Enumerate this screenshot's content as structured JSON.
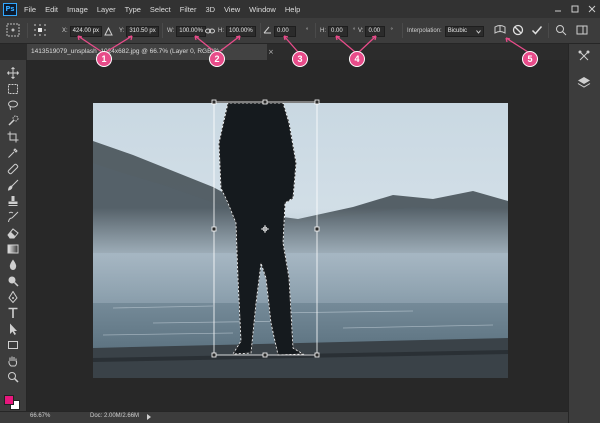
{
  "app": {
    "logo": "Ps"
  },
  "menu": [
    "File",
    "Edit",
    "Image",
    "Layer",
    "Type",
    "Select",
    "Filter",
    "3D",
    "View",
    "Window",
    "Help"
  ],
  "window_controls": [
    "minimize-icon",
    "maximize-icon",
    "close-icon"
  ],
  "options": {
    "x_label": "X:",
    "x_value": "424.00 px",
    "y_label": "Y:",
    "y_value": "310.50 px",
    "w_label": "W:",
    "w_value": "100.00%",
    "h_label": "H:",
    "h_value": "100.00%",
    "angle_value": "0.00",
    "angle_unit": "°",
    "hskew_label": "H:",
    "hskew_value": "0.00",
    "vskew_label": "V:",
    "vskew_value": "0.00",
    "skew_unit": "°",
    "interp_label": "Interpolation:",
    "interp_value": "Bicubic"
  },
  "callouts": [
    "1",
    "2",
    "3",
    "4",
    "5"
  ],
  "document": {
    "tab_title": "1413519079_unsplash_1024x682.jpg @ 66.7% (Layer 0, RGB/8) *",
    "tab_close": "×"
  },
  "status": {
    "zoom": "66.67%",
    "doc": "Doc: 2.00M/2.66M"
  },
  "tools": [
    "move-icon",
    "marquee-icon",
    "lasso-icon",
    "quick-select-icon",
    "crop-icon",
    "eyedropper-icon",
    "healing-icon",
    "brush-icon",
    "stamp-icon",
    "history-brush-icon",
    "eraser-icon",
    "gradient-icon",
    "blur-icon",
    "dodge-icon",
    "pen-icon",
    "type-icon",
    "path-select-icon",
    "rectangle-icon",
    "hand-icon",
    "zoom-icon"
  ],
  "colors": {
    "accent_pink": "#e84c8a",
    "foreground": "#e8177d",
    "background": "#ffffff",
    "ps_blue": "#31a8ff"
  }
}
